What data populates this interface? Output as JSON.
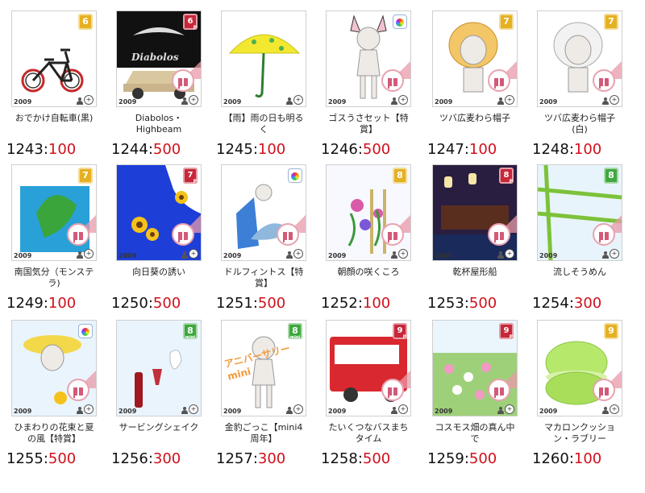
{
  "year_label": "2009",
  "items": [
    {
      "name": "おでかけ自転車(黒)",
      "id": "1243",
      "points": "100",
      "badge": "6",
      "badge_style": "gold"
    },
    {
      "name": "Diabolos・Highbeam",
      "id": "1244",
      "points": "500",
      "badge": "6",
      "badge_style": "red",
      "art_text": "Diabolos"
    },
    {
      "name": "【雨】雨の日も明るく",
      "id": "1245",
      "points": "100",
      "badge": "",
      "badge_style": "none"
    },
    {
      "name": "ゴスうさセット【特賞】",
      "id": "1246",
      "points": "500",
      "badge": "",
      "badge_style": "rainbow"
    },
    {
      "name": "ツバ広麦わら帽子",
      "id": "1247",
      "points": "100",
      "badge": "7",
      "badge_style": "gold"
    },
    {
      "name": "ツバ広麦わら帽子(白)",
      "id": "1248",
      "points": "100",
      "badge": "7",
      "badge_style": "gold"
    },
    {
      "name": "南国気分（モンステラ)",
      "id": "1249",
      "points": "100",
      "badge": "7",
      "badge_style": "gold"
    },
    {
      "name": "向日葵の誘い",
      "id": "1250",
      "points": "500",
      "badge": "7",
      "badge_style": "red"
    },
    {
      "name": "ドルフィントス【特賞】",
      "id": "1251",
      "points": "500",
      "badge": "",
      "badge_style": "rainbow"
    },
    {
      "name": "朝顔の咲くころ",
      "id": "1252",
      "points": "100",
      "badge": "8",
      "badge_style": "gold"
    },
    {
      "name": "乾杯屋形船",
      "id": "1253",
      "points": "500",
      "badge": "8",
      "badge_style": "red"
    },
    {
      "name": "流しそうめん",
      "id": "1254",
      "points": "300",
      "badge": "8",
      "badge_style": "green"
    },
    {
      "name": "ひまわりの花束と夏の風【特賞】",
      "id": "1255",
      "points": "500",
      "badge": "",
      "badge_style": "rainbow"
    },
    {
      "name": "サービングシェイク",
      "id": "1256",
      "points": "300",
      "badge": "8",
      "badge_style": "green"
    },
    {
      "name": "金豹ごっこ【mini4周年】",
      "id": "1257",
      "points": "300",
      "badge": "8",
      "badge_style": "green",
      "art_text": "アニバーサリー mini"
    },
    {
      "name": "たいくつなバスまちタイム",
      "id": "1258",
      "points": "500",
      "badge": "9",
      "badge_style": "red"
    },
    {
      "name": "コスモス畑の真ん中で",
      "id": "1259",
      "points": "500",
      "badge": "9",
      "badge_style": "red"
    },
    {
      "name": "マカロンクッション・ラブリー",
      "id": "1260",
      "points": "100",
      "badge": "9",
      "badge_style": "gold"
    }
  ]
}
